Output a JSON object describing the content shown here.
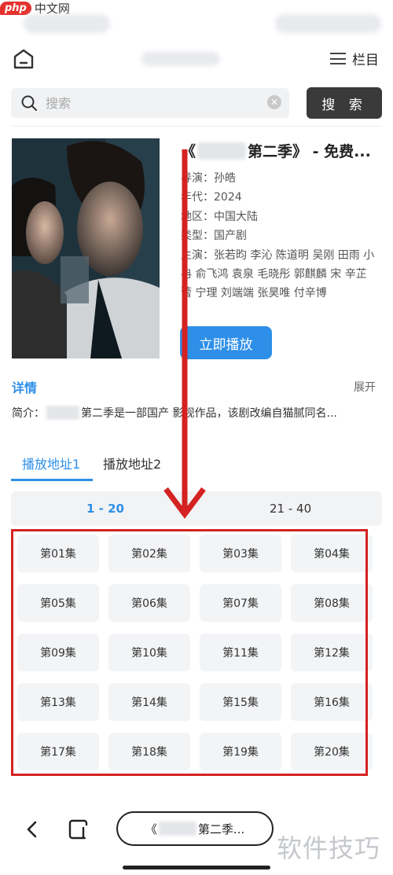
{
  "watermark_top": {
    "logo": "php",
    "text": "中文网"
  },
  "header": {
    "menu_label": "栏目"
  },
  "search": {
    "placeholder": "搜索",
    "button_label": "搜 索"
  },
  "video": {
    "title_prefix": "《",
    "title_suffix": "第二季》 - 免费...",
    "director": "导演：孙皓",
    "year": "年代：2024",
    "region": "地区：中国大陆",
    "genre": "类型：国产剧",
    "cast": "主演：张若昀 李沁 陈道明 吴刚 田雨 小冉 俞飞鸿 袁泉 毛晓彤 郭麒麟 宋 辛芷蕾 宁理 刘端端 张昊唯 付辛博",
    "play_label": "立即播放"
  },
  "details": {
    "label": "详情",
    "expand": "展开",
    "synopsis_prefix": "简介：",
    "synopsis_text": "第二季是一部国产 影视作品，该剧改编自猫腻同名..."
  },
  "source_tabs": [
    "播放地址1",
    "播放地址2"
  ],
  "range_tabs": [
    "1 - 20",
    "21 - 40"
  ],
  "episodes": [
    "第01集",
    "第02集",
    "第03集",
    "第04集",
    "第05集",
    "第06集",
    "第07集",
    "第08集",
    "第09集",
    "第10集",
    "第11集",
    "第12集",
    "第13集",
    "第14集",
    "第15集",
    "第16集",
    "第17集",
    "第18集",
    "第19集",
    "第20集"
  ],
  "bottom_bar": {
    "title_prefix": "《",
    "title_suffix": "第二季..."
  },
  "watermark_bottom": "软件技巧",
  "colors": {
    "accent": "#2e8fe8",
    "annotation_red": "#d42222",
    "search_button": "#3a3a3a"
  }
}
